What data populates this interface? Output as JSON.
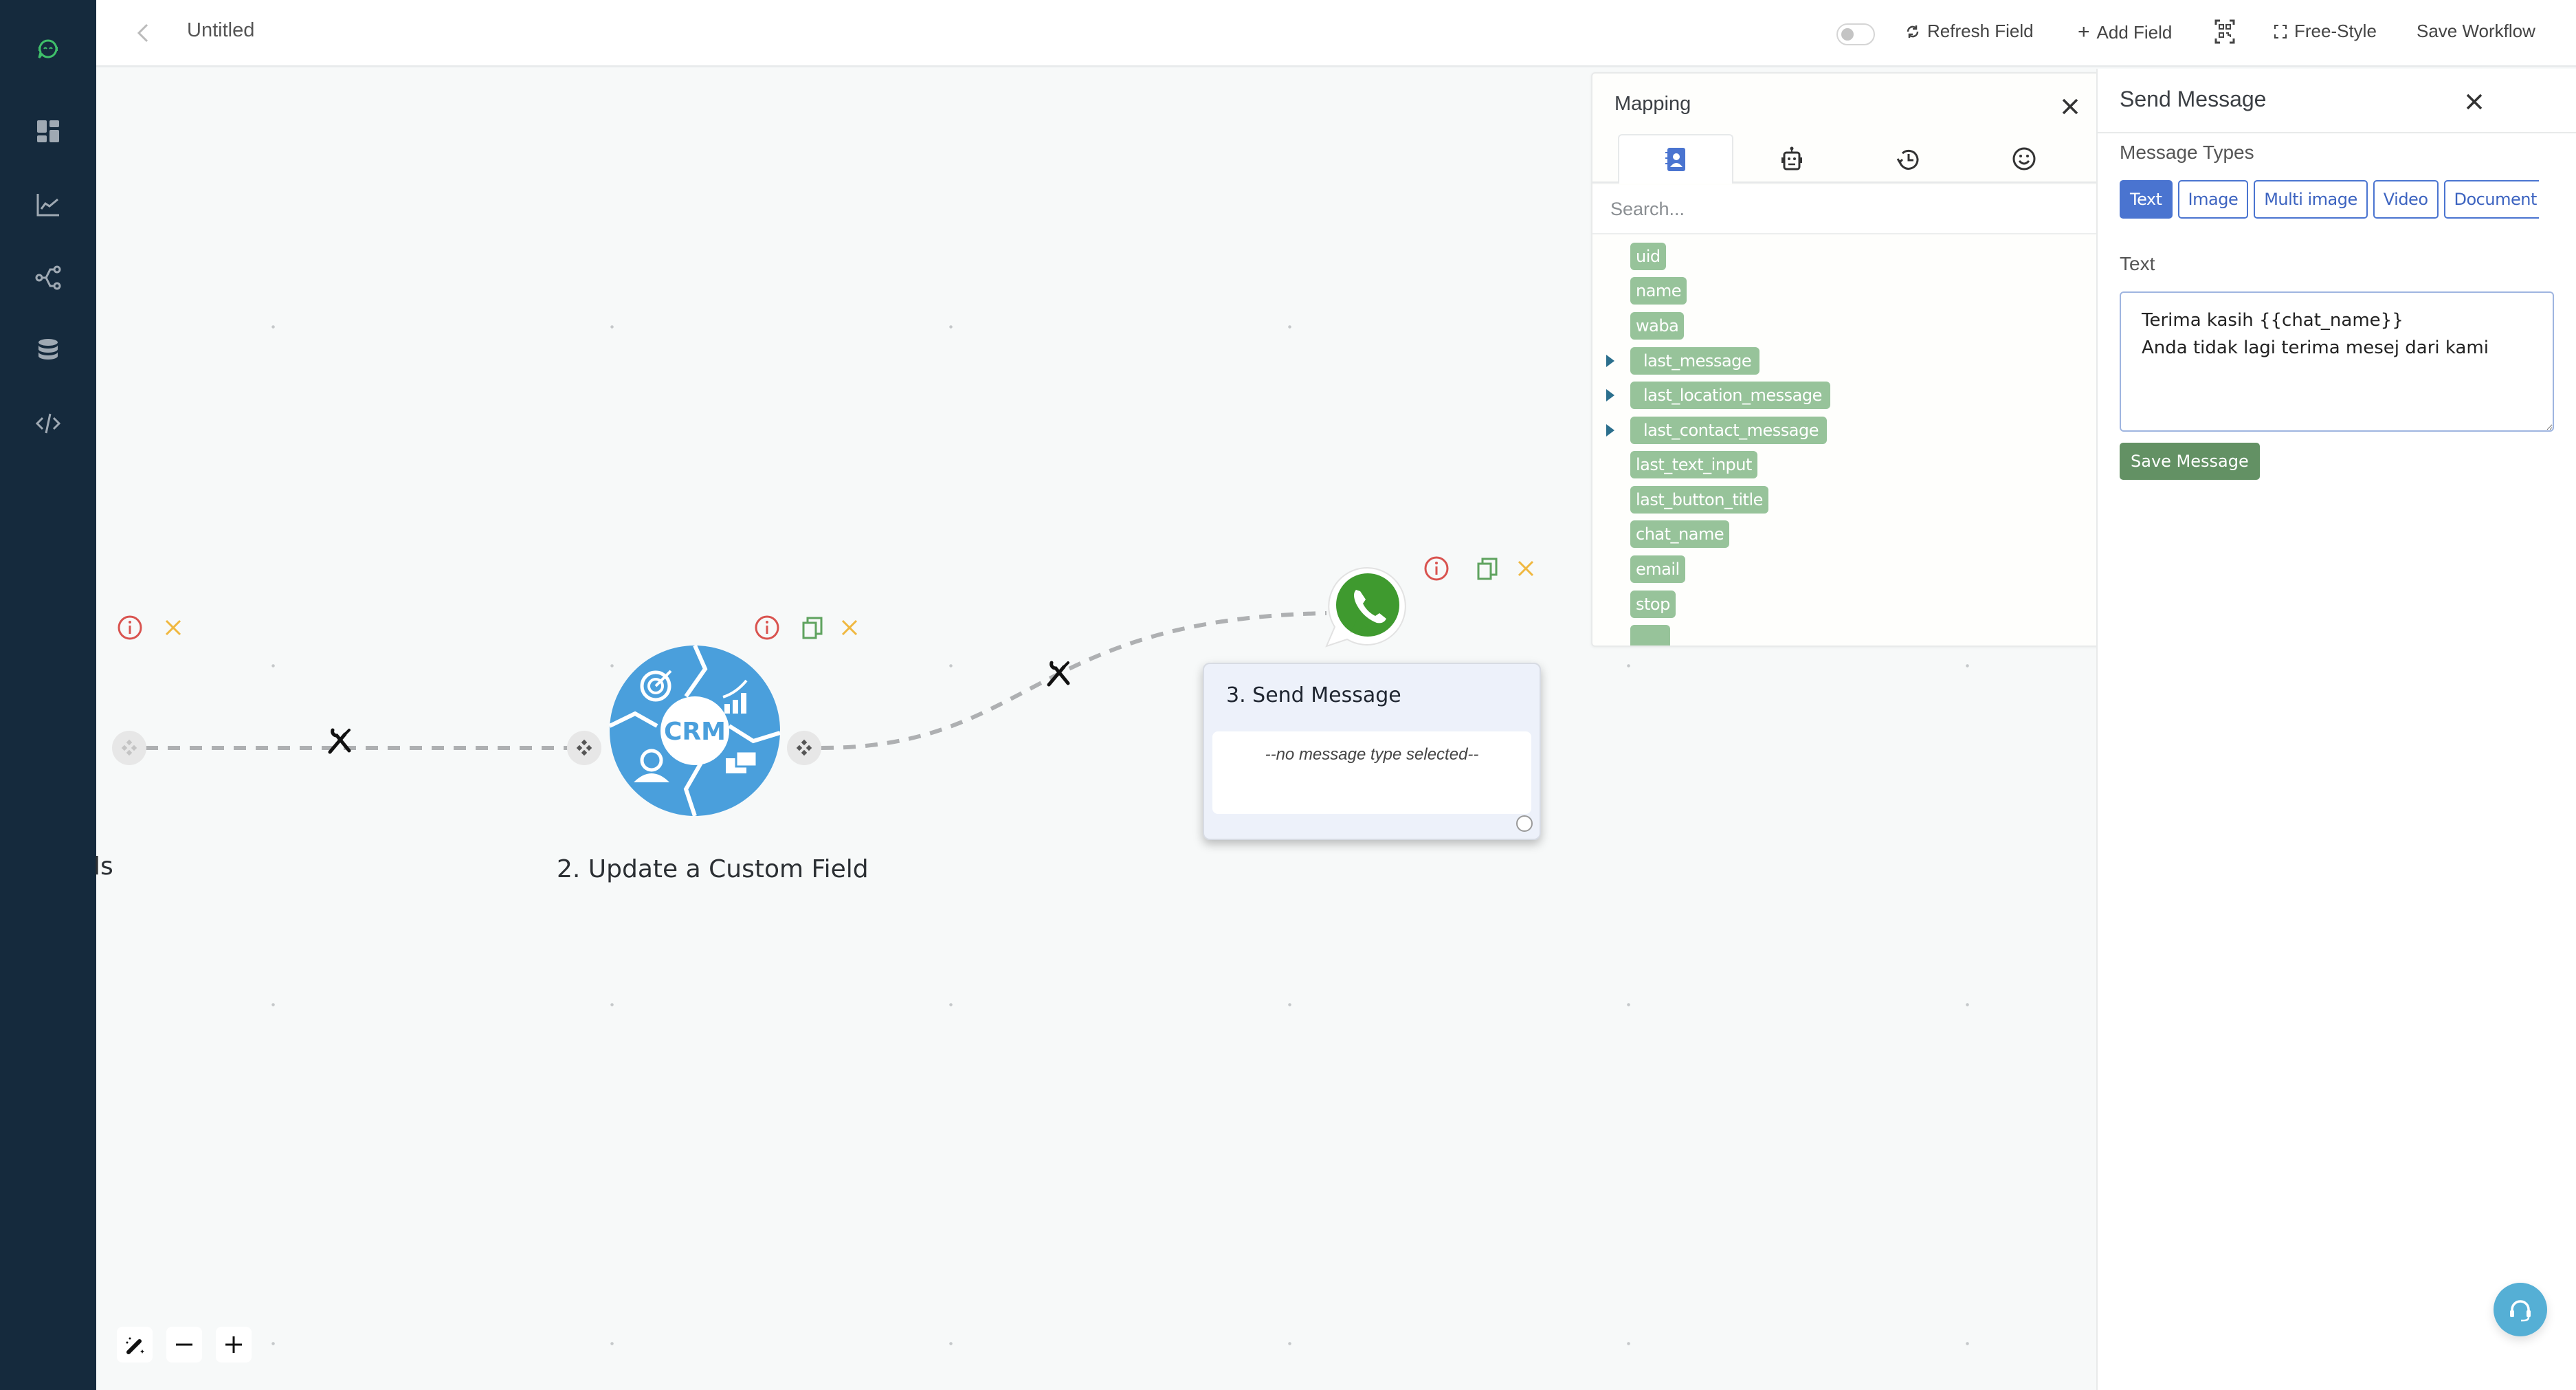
{
  "sidebar": {
    "logo": "chatbot-logo-icon",
    "items": [
      {
        "icon": "dashboard-icon"
      },
      {
        "icon": "analytics-chart-icon"
      },
      {
        "icon": "workflow-share-icon"
      },
      {
        "icon": "database-icon"
      },
      {
        "icon": "code-icon"
      }
    ]
  },
  "topbar": {
    "title": "Untitled",
    "toggle_on": false,
    "refresh_label": "Refresh Field",
    "add_field_label": "Add Field",
    "free_style_label": "Free-Style",
    "save_workflow_label": "Save Workflow"
  },
  "canvas": {
    "nodes": [
      {
        "id": 1,
        "label_partial": "ls"
      },
      {
        "id": 2,
        "label": "2. Update a Custom Field",
        "icon_text": "CRM"
      },
      {
        "id": 3,
        "label": "3. Send Message",
        "body": "--no message type selected--"
      }
    ]
  },
  "mapping": {
    "title": "Mapping",
    "tabs": [
      {
        "icon": "contact-book-icon",
        "active": true
      },
      {
        "icon": "robot-icon",
        "active": false
      },
      {
        "icon": "history-icon",
        "active": false
      },
      {
        "icon": "smiley-icon",
        "active": false
      }
    ],
    "search_placeholder": "Search...",
    "fields": [
      {
        "name": "uid",
        "expandable": false
      },
      {
        "name": "name",
        "expandable": false
      },
      {
        "name": "waba",
        "expandable": false
      },
      {
        "name": "last_message",
        "expandable": true
      },
      {
        "name": "last_location_message",
        "expandable": true
      },
      {
        "name": "last_contact_message",
        "expandable": true
      },
      {
        "name": "last_text_input",
        "expandable": false
      },
      {
        "name": "last_button_title",
        "expandable": false
      },
      {
        "name": "chat_name",
        "expandable": false
      },
      {
        "name": "email",
        "expandable": false
      },
      {
        "name": "stop",
        "expandable": false
      },
      {
        "name": "",
        "expandable": false
      }
    ]
  },
  "send_message": {
    "title": "Send Message",
    "message_types_label": "Message Types",
    "types": [
      {
        "label": "Text",
        "active": true
      },
      {
        "label": "Image",
        "active": false
      },
      {
        "label": "Multi image",
        "active": false
      },
      {
        "label": "Video",
        "active": false
      },
      {
        "label": "Document",
        "active": false
      }
    ],
    "text_label": "Text",
    "text_value": "Terima kasih {{chat_name}}\nAnda tidak lagi terima mesej dari kami",
    "save_label": "Save Message"
  },
  "colors": {
    "sidebar_bg": "#152a3d",
    "accent_blue": "#4a74d0",
    "chip_green": "#97c39a",
    "save_green": "#639164",
    "info_red": "#d9534f",
    "copy_green": "#5fa35f",
    "delete_yellow": "#f0b840",
    "help_blue": "#55afd5"
  }
}
